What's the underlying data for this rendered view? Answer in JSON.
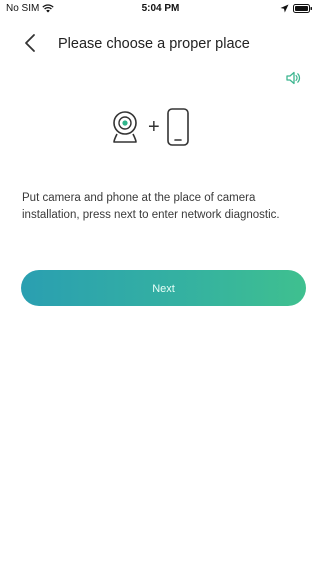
{
  "status_bar": {
    "carrier": "No SIM",
    "time": "5:04 PM"
  },
  "header": {
    "title": "Please choose a proper place"
  },
  "illustration": {
    "plus": "+"
  },
  "instructions": "Put camera and phone at the place of camera installation, press next to enter network diagnostic.",
  "next_button": {
    "label": "Next"
  },
  "colors": {
    "accent_start": "#2a9fb1",
    "accent_end": "#3fc08f",
    "speaker": "#3cb58f"
  },
  "icons": {
    "wifi": "wifi-icon",
    "location": "location-arrow-icon",
    "battery": "battery-icon",
    "back": "chevron-left-icon",
    "speaker": "speaker-icon",
    "camera": "camera-icon",
    "phone": "phone-icon"
  }
}
